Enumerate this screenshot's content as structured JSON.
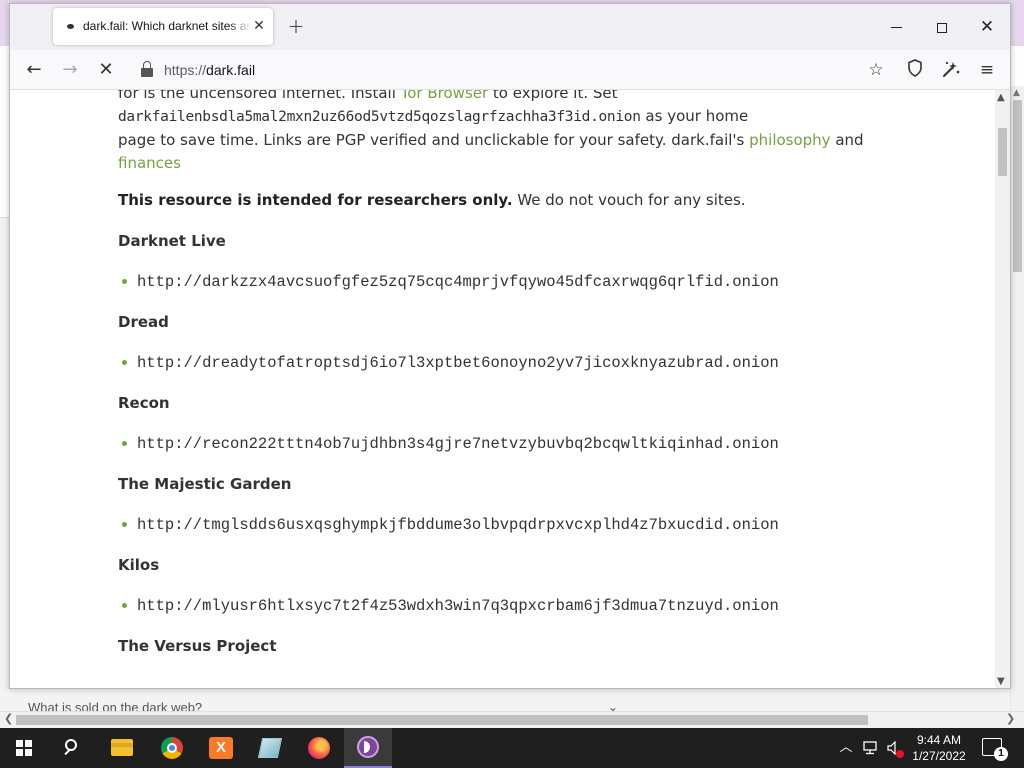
{
  "background_window": {
    "bottom_text": "What is sold on the dark web?"
  },
  "browser": {
    "tab_title": "dark.fail: Which darknet sites are online?",
    "url_prefix": "https://",
    "url_host": "dark.fail",
    "icons": {
      "back": "back-arrow-icon",
      "forward": "forward-arrow-icon",
      "stop": "stop-loading-icon",
      "lock": "lock-icon",
      "bookmark": "star-icon",
      "tracking": "shield-icon",
      "extensions": "extension-icon",
      "menu": "hamburger-menu-icon"
    }
  },
  "page": {
    "intro_line1": "for is the uncensored internet. Install ",
    "intro_link_tor": "Tor Browser",
    "intro_line1_end": " to explore it. Set",
    "home_onion": "darkfailenbsdla5mal2mxn2uz66od5vtzd5qozslagrfzachha3f3id.onion",
    "intro_line2_end": " as your home",
    "intro_line3": "page to save time. Links are PGP verified and unclickable for your safety. dark.fail's ",
    "link_philosophy": "philosophy",
    "and": " and ",
    "link_finances": "finances",
    "notice_bold": "This resource is intended for researchers only.",
    "notice_rest": " We do not vouch for any sites.",
    "sites": [
      {
        "name": "Darknet Live",
        "url": "http://darkzzx4avcsuofgfez5zq75cqc4mprjvfqywo45dfcaxrwqg6qrlfid.onion"
      },
      {
        "name": "Dread",
        "url": "http://dreadytofatroptsdj6io7l3xptbet6onoyno2yv7jicoxknyazubrad.onion"
      },
      {
        "name": "Recon",
        "url": "http://recon222tttn4ob7ujdhbn3s4gjre7netvzybuvbq2bcqwltkiqinhad.onion"
      },
      {
        "name": "The Majestic Garden",
        "url": "http://tmglsdds6usxqsghympkjfbddume3olbvpqdrpxvcxplhd4z7bxucdid.onion"
      },
      {
        "name": "Kilos",
        "url": "http://mlyusr6htlxsyc7t2f4z53wdxh3win7q3qpxcrbam6jf3dmua7tnzuyd.onion"
      },
      {
        "name": "The Versus Project",
        "url": ""
      }
    ]
  },
  "taskbar": {
    "time": "9:44 AM",
    "date": "1/27/2022",
    "notification_count": "1"
  },
  "colors": {
    "link_green": "#73a33f",
    "taskbar": "#1f1f1f",
    "tab_bar": "#f0f0f4"
  }
}
